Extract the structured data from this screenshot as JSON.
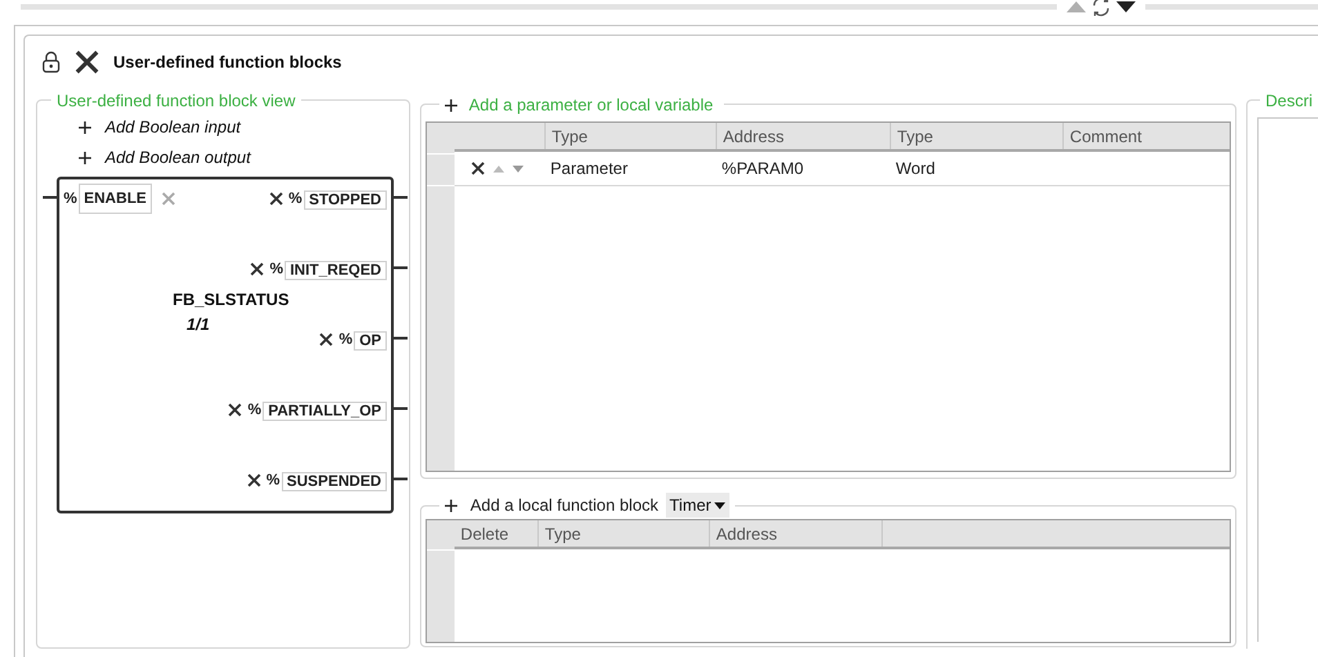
{
  "panel": {
    "title": "User-defined function blocks"
  },
  "block_view": {
    "legend": "User-defined function block view",
    "actions": [
      {
        "label": "Add Boolean input"
      },
      {
        "label": "Add Boolean output"
      }
    ],
    "block": {
      "name": "FB_SLSTATUS",
      "instance": "1/1",
      "inputs": [
        {
          "prefix": "%",
          "name": "ENABLE",
          "removable": false
        }
      ],
      "outputs": [
        {
          "prefix": "%",
          "name": "STOPPED",
          "removable": true
        },
        {
          "prefix": "%",
          "name": "INIT_REQED",
          "removable": true
        },
        {
          "prefix": "%",
          "name": "OP",
          "removable": true
        },
        {
          "prefix": "%",
          "name": "PARTIALLY_OP",
          "removable": true
        },
        {
          "prefix": "%",
          "name": "SUSPENDED",
          "removable": true
        }
      ]
    }
  },
  "parameters": {
    "legend": "Add a parameter or local variable",
    "columns": [
      "",
      "Type",
      "Address",
      "Type",
      "Comment"
    ],
    "rows": [
      {
        "kind_value": "Parameter",
        "address": "%PARAM0",
        "type": "Word",
        "comment": "",
        "selected": false
      }
    ]
  },
  "local_blocks": {
    "legend": "Add a local function block",
    "dropdown": "Timer",
    "columns": [
      "Delete",
      "Type",
      "Address"
    ]
  },
  "description": {
    "legend": "Descri"
  }
}
